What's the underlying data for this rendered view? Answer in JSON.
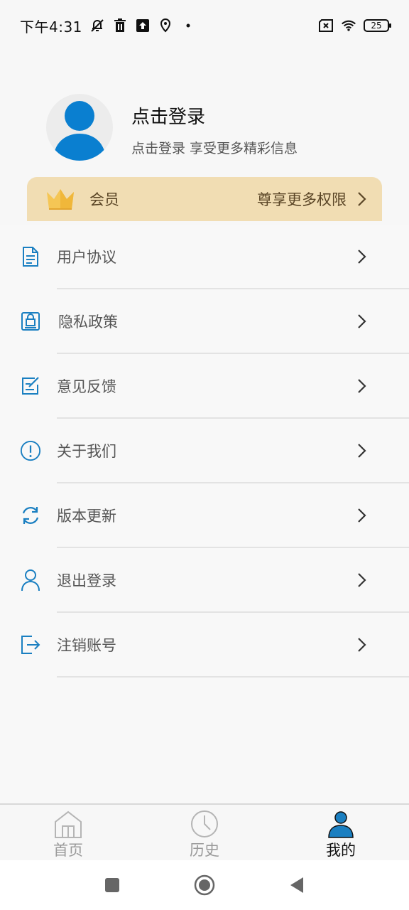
{
  "status_bar": {
    "time": "下午4:31",
    "battery_level": "25",
    "icons": [
      "mute-bell-icon",
      "trash-icon",
      "upload-icon",
      "location-icon",
      "dot-icon",
      "sim-x-icon",
      "wifi-icon",
      "battery-icon"
    ]
  },
  "profile": {
    "title": "点击登录",
    "subtitle": "点击登录 享受更多精彩信息",
    "avatar_icon": "user-avatar-icon"
  },
  "vip": {
    "label": "会员",
    "tagline": "尊享更多权限",
    "icon": "crown-icon",
    "background_color": "#f1ddb3"
  },
  "menu": {
    "items": [
      {
        "label": "用户协议",
        "icon": "document-icon"
      },
      {
        "label": "隐私政策",
        "icon": "lock-document-icon"
      },
      {
        "label": "意见反馈",
        "icon": "edit-note-icon"
      },
      {
        "label": "关于我们",
        "icon": "info-circle-icon"
      },
      {
        "label": "版本更新",
        "icon": "refresh-icon"
      },
      {
        "label": "退出登录",
        "icon": "person-icon"
      },
      {
        "label": "注销账号",
        "icon": "logout-icon"
      }
    ],
    "icon_color": "#1a7fc1"
  },
  "tabs": [
    {
      "label": "首页",
      "icon": "home-icon",
      "active": false
    },
    {
      "label": "历史",
      "icon": "clock-icon",
      "active": false
    },
    {
      "label": "我的",
      "icon": "profile-icon",
      "active": true
    }
  ],
  "colors": {
    "accent": "#1a7fc1",
    "avatar_blue": "#0a7fd0"
  }
}
